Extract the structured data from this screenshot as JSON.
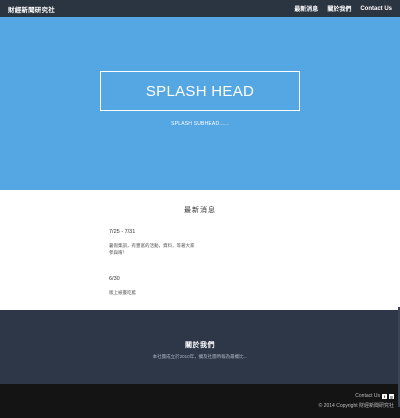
{
  "navbar": {
    "brand": "財經新聞研究社",
    "links": [
      {
        "label": "最新消息"
      },
      {
        "label": "關於我們"
      },
      {
        "label": "Contact Us"
      }
    ]
  },
  "hero": {
    "title": "SPLASH HEAD",
    "subtitle": "SPLASH SUBHEAD......"
  },
  "news": {
    "title": "最新消息",
    "items": [
      {
        "date": "7/25 - 7/31",
        "body_line1": "暑假集訓，有豐富的活動，資料，等著大家",
        "body_line2": "參與唷！"
      },
      {
        "date": "6/30",
        "body_line1": "版上被臺吃藍",
        "body_line2": ""
      }
    ]
  },
  "about": {
    "title": "關於我們",
    "text": "本社團成立於2010年，擴及社團時報為最權比..."
  },
  "footer": {
    "contact_label": "Contact Us",
    "icons": [
      "facebook-icon",
      "google-plus-icon"
    ],
    "copyright": "© 2014 Copyright 財經新聞研究社"
  },
  "colors": {
    "navbar_bg": "#2b3441",
    "hero_bg": "#55a7e3",
    "about_bg": "#2d3748",
    "footer_bg": "#141414"
  }
}
